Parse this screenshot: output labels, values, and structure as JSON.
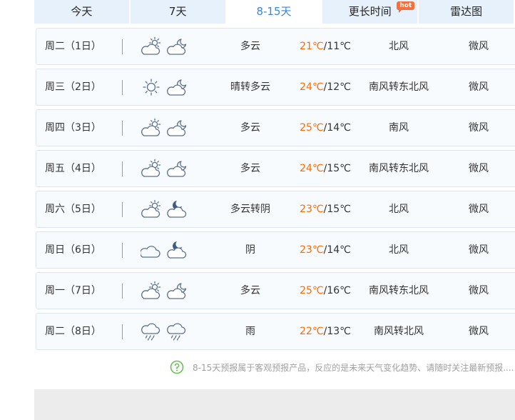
{
  "tabs": [
    {
      "label": "今天"
    },
    {
      "label": "7天"
    },
    {
      "label": "8-15天"
    },
    {
      "label": "更长时间",
      "badge": "hot"
    },
    {
      "label": "雷达图"
    }
  ],
  "forecast": [
    {
      "day": "周二（1日）",
      "icons": [
        "cloudy-sun-icon",
        "moon-cloud-icon"
      ],
      "condition": "多云",
      "high": "21℃",
      "low": "/11℃",
      "wind": "北风",
      "level": "微风"
    },
    {
      "day": "周三（2日）",
      "icons": [
        "sun-icon",
        "moon-cloud-icon"
      ],
      "condition": "晴转多云",
      "high": "24℃",
      "low": "/12℃",
      "wind": "南风转东北风",
      "level": "微风"
    },
    {
      "day": "周四（3日）",
      "icons": [
        "cloudy-sun-icon",
        "moon-cloud-icon"
      ],
      "condition": "多云",
      "high": "25℃",
      "low": "/14℃",
      "wind": "南风",
      "level": "微风"
    },
    {
      "day": "周五（4日）",
      "icons": [
        "cloudy-sun-icon",
        "moon-cloud-icon"
      ],
      "condition": "多云",
      "high": "24℃",
      "low": "/15℃",
      "wind": "南风转东北风",
      "level": "微风"
    },
    {
      "day": "周六（5日）",
      "icons": [
        "cloudy-sun-icon",
        "overcast-night-icon"
      ],
      "condition": "多云转阴",
      "high": "23℃",
      "low": "/15℃",
      "wind": "北风",
      "level": "微风"
    },
    {
      "day": "周日（6日）",
      "icons": [
        "overcast-icon",
        "overcast-night-icon"
      ],
      "condition": "阴",
      "high": "23℃",
      "low": "/14℃",
      "wind": "北风",
      "level": "微风"
    },
    {
      "day": "周一（7日）",
      "icons": [
        "cloudy-sun-icon",
        "moon-cloud-icon"
      ],
      "condition": "多云",
      "high": "25℃",
      "low": "/16℃",
      "wind": "南风转东北风",
      "level": "微风"
    },
    {
      "day": "周二（8日）",
      "icons": [
        "rain-icon",
        "rain-icon"
      ],
      "condition": "雨",
      "high": "22℃",
      "low": "/13℃",
      "wind": "南风转北风",
      "level": "微风"
    }
  ],
  "note": {
    "icon": "question-circle-icon",
    "text": "8-15天预报属于客观预报产品，反应的是未来天气变化趋势、请随时关注最新预报....."
  },
  "colors": {
    "tab_bg": "#e6f1fb",
    "active_tab_text": "#3a86d9",
    "high_temp": "#ff6a00",
    "hot_badge": "#f0703f"
  }
}
